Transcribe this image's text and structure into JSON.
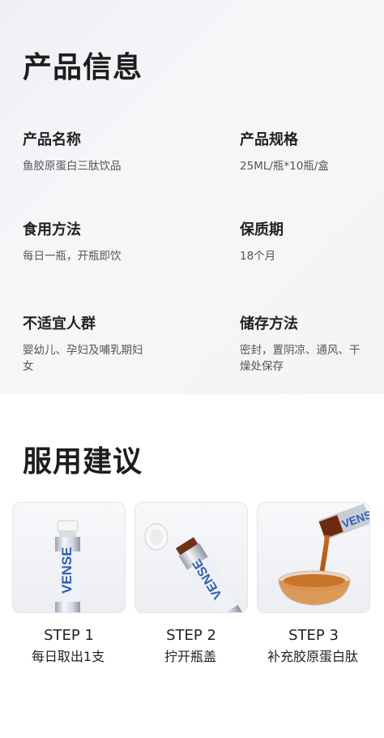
{
  "info_section": {
    "title": "产品信息",
    "fields": [
      {
        "label": "产品名称",
        "value": "鱼胶原蛋白三肽饮品"
      },
      {
        "label": "产品规格",
        "value": "25ML/瓶*10瓶/盒"
      },
      {
        "label": "食用方法",
        "value": "每日一瓶，开瓶即饮"
      },
      {
        "label": "保质期",
        "value": "18个月"
      },
      {
        "label": "不适宜人群",
        "value": "婴幼儿、孕妇及哺乳期妇女"
      },
      {
        "label": "储存方法",
        "value": "密封，置阴凉、通风、干燥处保存"
      }
    ]
  },
  "usage_section": {
    "title": "服用建议",
    "steps": [
      {
        "step": "STEP 1",
        "desc": "每日取出1支",
        "icon": "vial-upright-icon"
      },
      {
        "step": "STEP 2",
        "desc": "拧开瓶盖",
        "icon": "vial-cap-open-icon"
      },
      {
        "step": "STEP 3",
        "desc": "补充胶原蛋白肽",
        "icon": "vial-pouring-icon"
      }
    ]
  },
  "brand": {
    "logo_text": "VENSE",
    "accent": "#2f5fb3"
  }
}
